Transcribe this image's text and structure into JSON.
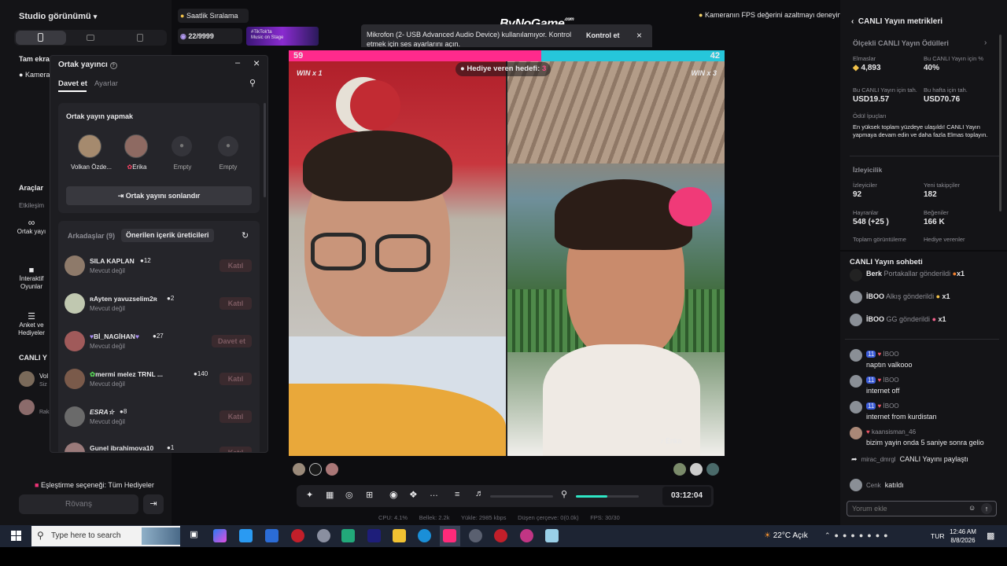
{
  "left": {
    "studio_title": "Studio görünümü",
    "tam_ekran": "Tam ekran",
    "kamera": "Kamera",
    "araclar": "Araçlar",
    "etkilesim": "Etkileşim",
    "ortak_yayin": "Ortak yayı",
    "interaktif": "İnteraktif Oyunlar",
    "anket": "Anket ve Hediyeler",
    "canli": "CANLI Y",
    "viewer1_name": "Vol",
    "viewer1_sub": "Siz",
    "viewer2_sub": "Rak",
    "eslestirme": "Eşleştirme seçeneği: Tüm Hediyeler",
    "rovans": "Rövanş"
  },
  "top": {
    "saatlik": "Saatlik Sıralama",
    "counter": "22/9999",
    "banner_line1": "#TikTok'ta",
    "banner_line2": "Music on Stage",
    "watermark": "ByNoGame",
    "watermark_sup": ".com",
    "fps_tip": "Kameranın FPS değerini azaltmayı deneyin"
  },
  "toast": {
    "message": "Mikrofon (2- USB Advanced Audio Device) kullanılamıyor. Kontrol etmek için ses ayarlarını açın.",
    "action": "Kontrol et"
  },
  "popup": {
    "title": "Ortak yayıncı",
    "tab_davet": "Davet et",
    "tab_ayarlar": "Ayarlar",
    "section_title": "Ortak yayın yapmak",
    "slots": [
      "Volkan Özde...",
      "Erika",
      "Empty",
      "Empty"
    ],
    "end_button": "Ortak yayını sonlandır",
    "tab_friends": "Arkadaşlar (9)",
    "tab_suggested": "Önerilen içerik üreticileri",
    "friends": [
      {
        "name": "SILA KAPLAN",
        "count": "12",
        "status": "Mevcut değil",
        "action": "Katıl"
      },
      {
        "name": "ʀAyten yavuzselim2ʀ",
        "count": "2",
        "status": "Mevcut değil",
        "action": "Katıl"
      },
      {
        "name": "Bİ_NAGİHAN",
        "count": "27",
        "status": "Mevcut değil",
        "action": "Davet et"
      },
      {
        "name": "mermi melez TRNL ...",
        "count": "140",
        "status": "Mevcut değil",
        "action": "Katıl"
      },
      {
        "name": "ESRA☆",
        "count": "8",
        "status": "Mevcut değil",
        "action": "Katıl"
      },
      {
        "name": "Gunel ibrahimova10",
        "count": "1",
        "status": "",
        "action": "Katıl"
      }
    ]
  },
  "battle": {
    "score_left": "59",
    "score_right": "42",
    "win_left": "WIN x 1",
    "win_right": "WIN x 3",
    "gift_goal_label": "Hediye veren hedefi:",
    "gift_goal_value": "3",
    "left_share": 0.58,
    "guest_name": "Erika"
  },
  "controls": {
    "timer": "03:12:04",
    "volume_level": 0.55,
    "mic_level": 0.5
  },
  "stats": {
    "cpu": "CPU: 4.1%",
    "bellek": "Bellek: 2.2k",
    "yukle": "Yükle: 2985 kbps",
    "dusen": "Düşen çerçeve: 0(0.0k)",
    "fps": "FPS: 30/30"
  },
  "metrics": {
    "title": "CANLI Yayın metrikleri",
    "rewards_title": "Ölçekli CANLI Yayın Ödülleri",
    "elmaslar_label": "Elmaslar",
    "elmaslar_value": "4,893",
    "bu_canli_label": "Bu CANLI Yayın için %",
    "bu_canli_value": "40%",
    "tah_label": "Bu CANLI Yayın için tah.",
    "tah_value": "USD19.57",
    "hafta_label": "Bu hafta için tah.",
    "hafta_value": "USD70.76",
    "tips_label": "Ödül İpuçları",
    "tips_text": "En yüksek toplam yüzdeye ulaşıldı! CANLI Yayın yapmaya devam edin ve daha fazla Elmas toplayın.",
    "izleyicilik": "İzleyicilik",
    "izleyiciler_label": "İzleyiciler",
    "izleyiciler_value": "92",
    "takipci_label": "Yeni takipçiler",
    "takipci_value": "182",
    "hayranlar_label": "Hayranlar",
    "hayranlar_value": "548 (+25 )",
    "begeniler_label": "Beğeniler",
    "begeniler_value": "166 K",
    "toplam_label": "Toplam görüntüleme",
    "hediye_label": "Hediye verenler"
  },
  "chat": {
    "title": "CANLI Yayın sohbeti",
    "gifts": [
      {
        "user": "Berk",
        "text": "Portakallar gönderildi",
        "count": "x1"
      },
      {
        "user": "İBOO",
        "text": "Alkış gönderildi",
        "count": "x1"
      },
      {
        "user": "İBOO",
        "text": "GG gönderildi",
        "count": "x1"
      }
    ],
    "messages": [
      {
        "badge": "11",
        "user": "İBOO",
        "text": "naptın valkooo"
      },
      {
        "badge": "11",
        "user": "İBOO",
        "text": "internet off"
      },
      {
        "badge": "11",
        "user": "İBOO",
        "text": "internet from kurdistan"
      },
      {
        "badge": "",
        "user": "kaansisman_46",
        "text": "bizim yayin onda 5 saniye sonra gelio"
      }
    ],
    "share_user": "mirac_dmrgl",
    "share_text": "CANLI Yayını paylaştı",
    "join_user": "Cenk",
    "join_text": "katıldı",
    "input_placeholder": "Yorum ekle"
  },
  "taskbar": {
    "search_placeholder": "Type here to search",
    "weather": "22°C  Açık",
    "lang": "TUR",
    "time": "12:46 AM",
    "date": "8/8/2026"
  }
}
